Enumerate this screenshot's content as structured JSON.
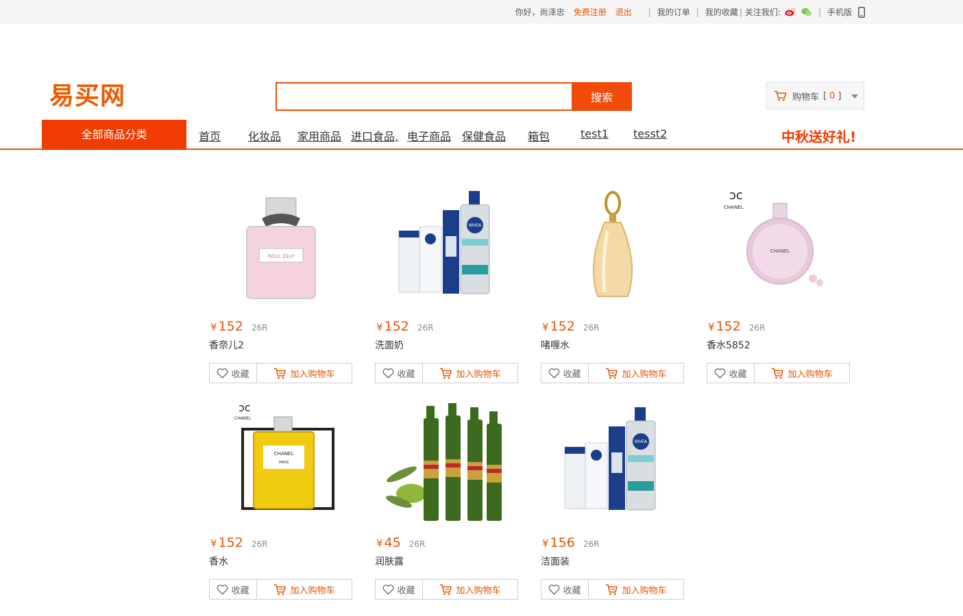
{
  "topbar": {
    "greeting": "你好，尚泽忠",
    "register": "免费注册",
    "logout": "退出",
    "orders": "我的订单",
    "favorites": "我的收藏",
    "follow": "关注我们:",
    "mobile": "手机版"
  },
  "header": {
    "logo": "易买网",
    "search_button": "搜索",
    "search_value": "",
    "cart_label": "购物车",
    "cart_count": "0"
  },
  "nav": {
    "all_categories": "全部商品分类",
    "items": [
      "首页",
      "化妆品",
      "家用商品",
      "进口食品,",
      "电子商品",
      "保健食品",
      "箱包",
      "test1",
      "tesst2"
    ],
    "promo": "中秋送好礼!"
  },
  "products": [
    {
      "price": "152",
      "sold": "26R",
      "name": "香奈儿2",
      "img": "perfume-pink"
    },
    {
      "price": "152",
      "sold": "26R",
      "name": "洗面奶",
      "img": "nivea-set"
    },
    {
      "price": "152",
      "sold": "26R",
      "name": "啫喱水",
      "img": "perfume-gold"
    },
    {
      "price": "152",
      "sold": "26R",
      "name": "香水5852",
      "img": "chanel-chance"
    },
    {
      "price": "152",
      "sold": "26R",
      "name": "香水",
      "img": "chanel-no5"
    },
    {
      "price": "45",
      "sold": "26R",
      "name": "润肤露",
      "img": "olive-oil"
    },
    {
      "price": "156",
      "sold": "26R",
      "name": "洁面装",
      "img": "nivea-set"
    }
  ],
  "labels": {
    "currency": "¥",
    "favorite": "收藏",
    "add_to_cart": "加入购物车"
  },
  "colors": {
    "accent": "#f04b0a",
    "price": "#e85200"
  }
}
